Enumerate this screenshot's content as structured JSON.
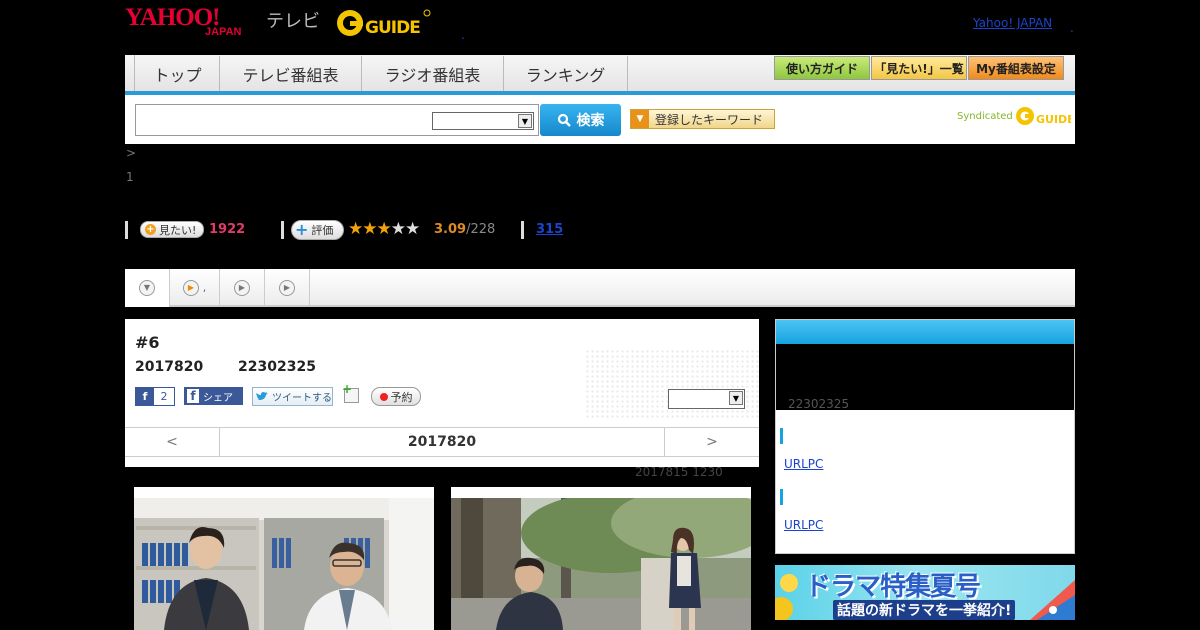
{
  "header": {
    "logo_yahoo": "YAHOO!",
    "logo_japan": "JAPAN",
    "logo_tv": "テレビ",
    "logo_g": "G GUIDE",
    "yahoo_japan_link": "Yahoo! JAPAN",
    "dot": "."
  },
  "nav": {
    "tabs": [
      "トップ",
      "テレビ番組表",
      "ラジオ番組表",
      "ランキング"
    ],
    "guide_buttons": [
      "使い方ガイド",
      "「見たい!」一覧",
      "My番組表設定"
    ]
  },
  "search": {
    "input_value": "",
    "select_value": "",
    "button_label": "検索",
    "keyword_button": "登録したキーワード",
    "syndicated": "Syndicated",
    "syndicated_logo": "GUIDE"
  },
  "breadcrumb": {
    "arrow": ">",
    "page": "1"
  },
  "stats": {
    "want_label": "見たい!",
    "want_count": "1922",
    "rate_label": "評価",
    "rating_value": 3.09,
    "rating_text": "3.09",
    "rating_count": "/228",
    "stars_filled": 3,
    "stars_total": 5,
    "link_count": "315"
  },
  "tabs_bar": {
    "second_label": ","
  },
  "episode": {
    "title": "#6",
    "date": "2017820",
    "time": "22302325",
    "fb_count": "2",
    "fb_share": "シェア",
    "tweet": "ツイートする",
    "reserve": "予約",
    "select_value": "",
    "pager_prev": "<",
    "pager_date": "2017820",
    "pager_next": ">",
    "updated": "2017815  1230"
  },
  "sidebar": {
    "time": "22302325",
    "link1": "URLPC",
    "link2": "URLPC"
  },
  "banner": {
    "title": "ドラマ特集夏号",
    "subtitle": "話題の新ドラマを一挙紹介!"
  },
  "colors": {
    "accent_blue": "#2a9bd6",
    "want_pink": "#e23b6a",
    "rating_orange": "#e08a26",
    "yahoo_red": "#e60033"
  }
}
